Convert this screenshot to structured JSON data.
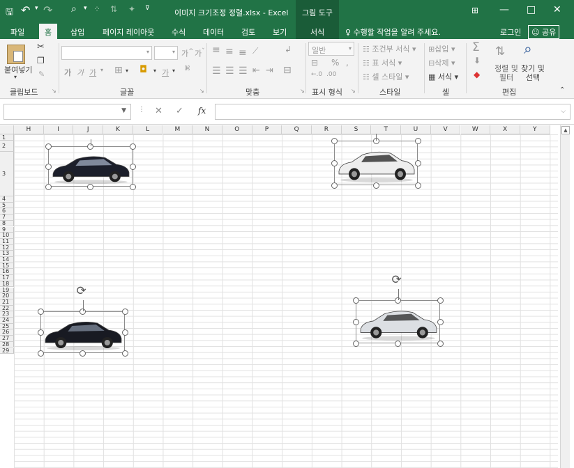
{
  "window": {
    "title": "이미지 크기조정 정렬.xlsx - Excel",
    "context_tool": "그림 도구",
    "save_icon": "save-icon",
    "undo_icon": "undo-icon",
    "redo_icon": "redo-icon",
    "controls": [
      "restore-ribbon-icon",
      "minimize-icon",
      "maximize-icon",
      "close-icon"
    ]
  },
  "tabs": [
    {
      "label": "파일"
    },
    {
      "label": "홈",
      "active": true
    },
    {
      "label": "삽입"
    },
    {
      "label": "페이지 레이아웃"
    },
    {
      "label": "수식"
    },
    {
      "label": "데이터"
    },
    {
      "label": "검토"
    },
    {
      "label": "보기"
    },
    {
      "label": "서식",
      "context": true
    }
  ],
  "tell_me": "수행할 작업을 알려 주세요.",
  "login": "로그인",
  "share": "공유",
  "ribbon": {
    "clipboard": {
      "label": "클립보드",
      "paste": "붙여넣기"
    },
    "font": {
      "label": "글꼴",
      "bold": "가",
      "italic": "가",
      "underline": "가"
    },
    "alignment": {
      "label": "맞춤"
    },
    "number": {
      "label": "표시 형식",
      "format": "일반"
    },
    "styles": {
      "label": "스타일",
      "conditional": "조건부 서식",
      "table": "표 서식",
      "cell": "셀 스타일"
    },
    "cells": {
      "label": "셀",
      "insert": "삽입",
      "delete": "삭제",
      "format": "서식"
    },
    "editing": {
      "label": "편집",
      "sort_filter": "정렬 및 필터",
      "find_select": "찾기 및 선택"
    }
  },
  "formula_bar": {
    "name_box": "",
    "formula": "",
    "fx": "fx"
  },
  "columns": [
    "H",
    "I",
    "J",
    "K",
    "L",
    "M",
    "N",
    "O",
    "P",
    "Q",
    "R",
    "S",
    "T",
    "U",
    "V",
    "W",
    "X",
    "Y"
  ],
  "rows": [
    "1",
    "2",
    "3",
    "4",
    "5",
    "6",
    "7",
    "8",
    "9",
    "10",
    "11",
    "12",
    "13",
    "14",
    "15",
    "16",
    "17",
    "18",
    "19",
    "20",
    "21",
    "22",
    "23",
    "24",
    "25",
    "26",
    "27",
    "28",
    "29"
  ],
  "pictures": [
    {
      "name": "car-image-dark-sedan",
      "color": "#1c1f2b",
      "accent": "#9aa4b8"
    },
    {
      "name": "car-image-white-sedan",
      "color": "#eeeeee",
      "accent": "#2a2a2a"
    },
    {
      "name": "car-image-black-limousine",
      "color": "#181a22",
      "accent": "#7a8496"
    },
    {
      "name": "car-image-silver-sedan",
      "color": "#dcdfe3",
      "accent": "#333"
    }
  ]
}
